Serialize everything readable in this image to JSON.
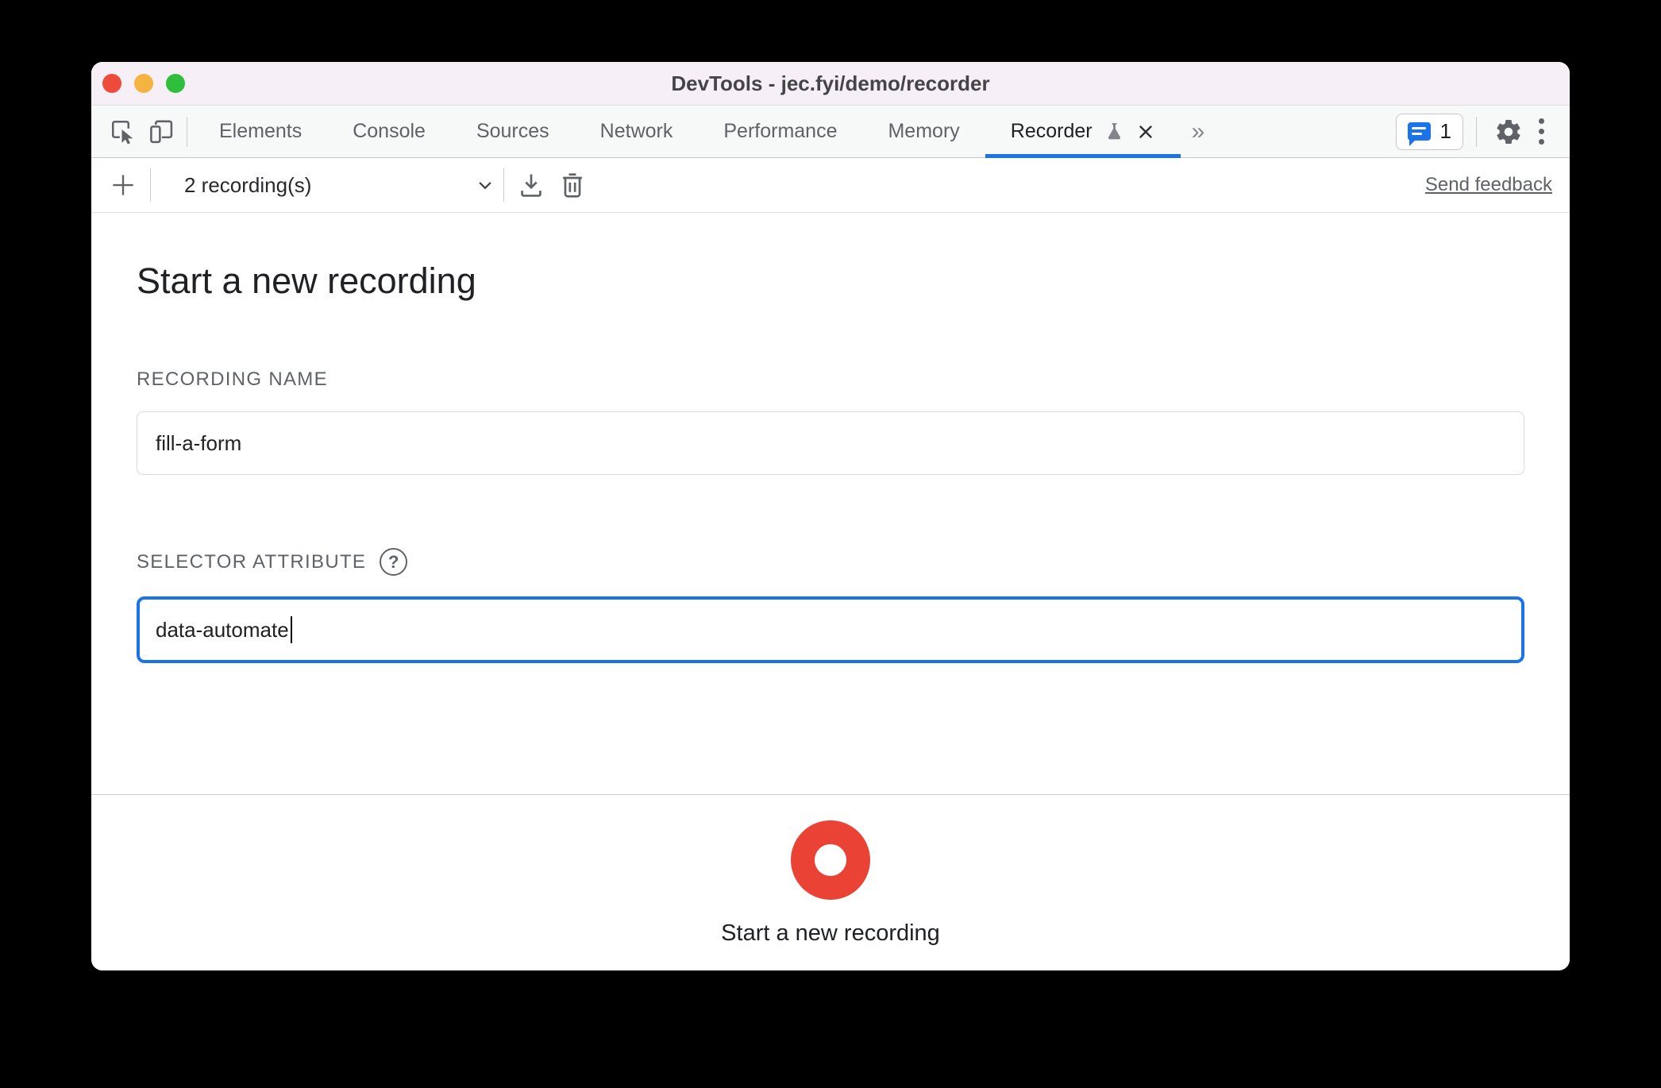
{
  "window": {
    "title": "DevTools - jec.fyi/demo/recorder"
  },
  "tabs": {
    "items": [
      "Elements",
      "Console",
      "Sources",
      "Network",
      "Performance",
      "Memory"
    ],
    "active": "Recorder",
    "overflow_glyph": "»",
    "issues_count": "1"
  },
  "toolbar": {
    "recordings_label": "2 recording(s)",
    "feedback_label": "Send feedback"
  },
  "main": {
    "heading": "Start a new recording",
    "recording_name": {
      "label": "RECORDING NAME",
      "value": "fill-a-form"
    },
    "selector_attribute": {
      "label": "SELECTOR ATTRIBUTE",
      "help_glyph": "?",
      "value": "data-automate"
    }
  },
  "footer": {
    "record_cta": "Start a new recording"
  },
  "colors": {
    "accent_blue": "#1a73e8",
    "record_red": "#ea4335",
    "traffic_red": "#ef4b3c",
    "traffic_yellow": "#f5b33f",
    "traffic_green": "#2fbf3d",
    "titlebar_bg": "#f6eff5"
  }
}
